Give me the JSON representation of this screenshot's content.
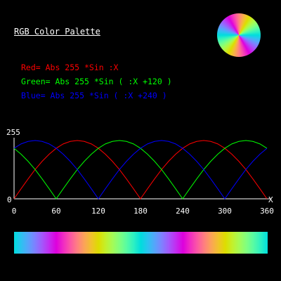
{
  "title": "RGB Color Palette",
  "formulas": {
    "red": "Red= Abs 255 *Sin :X",
    "green": "Green= Abs 255 *Sin ( :X +120 )",
    "blue": "Blue= Abs 255 *Sin ( :X +240 )"
  },
  "colors": {
    "red": "#ff0000",
    "green": "#00ff00",
    "blue": "#0000ff",
    "text": "#ffffff",
    "axis": "#ffffff"
  },
  "chart_data": {
    "type": "line",
    "title": "",
    "xlabel": "X",
    "ylabel": "",
    "xlim": [
      0,
      360
    ],
    "ylim": [
      0,
      255
    ],
    "x_ticks": [
      "0",
      "60",
      "120",
      "180",
      "240",
      "300",
      "360"
    ],
    "y_ticks": [
      "0",
      "255"
    ],
    "x_step": 10,
    "series": [
      {
        "color": "#ff0000",
        "x": [
          0,
          10,
          20,
          30,
          40,
          50,
          60,
          70,
          80,
          90,
          100,
          110,
          120,
          130,
          140,
          150,
          160,
          170,
          180,
          190,
          200,
          210,
          220,
          230,
          240,
          250,
          260,
          270,
          280,
          290,
          300,
          310,
          320,
          330,
          340,
          350,
          360
        ],
        "values": [
          0,
          44,
          87,
          128,
          164,
          195,
          221,
          240,
          251,
          255,
          251,
          240,
          221,
          195,
          164,
          128,
          87,
          44,
          0,
          44,
          87,
          128,
          164,
          195,
          221,
          240,
          251,
          255,
          251,
          240,
          221,
          195,
          164,
          128,
          87,
          44,
          0
        ]
      },
      {
        "color": "#00ff00",
        "x": [
          0,
          10,
          20,
          30,
          40,
          50,
          60,
          70,
          80,
          90,
          100,
          110,
          120,
          130,
          140,
          150,
          160,
          170,
          180,
          190,
          200,
          210,
          220,
          230,
          240,
          250,
          260,
          270,
          280,
          290,
          300,
          310,
          320,
          330,
          340,
          350,
          360
        ],
        "values": [
          221,
          195,
          164,
          128,
          87,
          44,
          0,
          44,
          87,
          128,
          164,
          195,
          221,
          240,
          251,
          255,
          251,
          240,
          221,
          195,
          164,
          128,
          87,
          44,
          0,
          44,
          87,
          128,
          164,
          195,
          221,
          240,
          251,
          255,
          251,
          240,
          221
        ]
      },
      {
        "color": "#0000ff",
        "x": [
          0,
          10,
          20,
          30,
          40,
          50,
          60,
          70,
          80,
          90,
          100,
          110,
          120,
          130,
          140,
          150,
          160,
          170,
          180,
          190,
          200,
          210,
          220,
          230,
          240,
          250,
          260,
          270,
          280,
          290,
          300,
          310,
          320,
          330,
          340,
          350,
          360
        ],
        "values": [
          221,
          240,
          251,
          255,
          251,
          240,
          221,
          195,
          164,
          128,
          87,
          44,
          0,
          44,
          87,
          128,
          164,
          195,
          221,
          240,
          251,
          255,
          251,
          240,
          221,
          195,
          164,
          128,
          87,
          44,
          0,
          44,
          87,
          128,
          164,
          195,
          221
        ]
      }
    ]
  }
}
